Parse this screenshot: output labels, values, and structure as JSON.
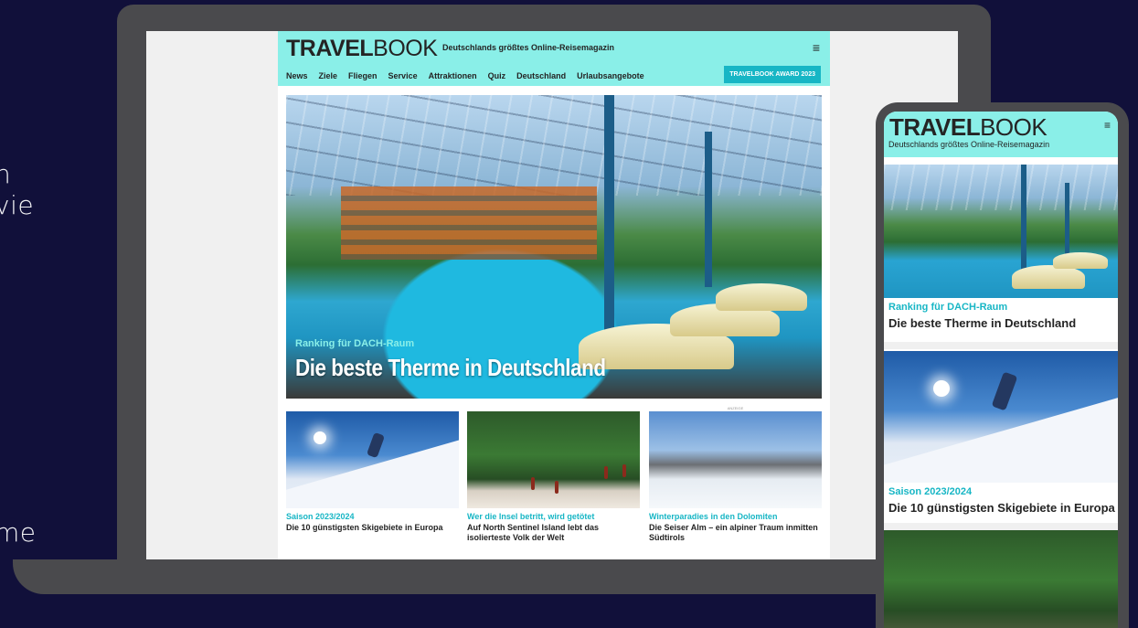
{
  "background": {
    "left_text": [
      "n",
      "vie",
      "me"
    ]
  },
  "colors": {
    "brand_cyan": "#8aefe8",
    "accent": "#17b6c5",
    "page_bg": "#11103a",
    "device": "#4a4a4d"
  },
  "desktop": {
    "logo_bold": "TRAVEL",
    "logo_light": "BOOK",
    "tagline": "Deutschlands größtes Online-Reisemagazin",
    "menu_icon": "≡",
    "nav": [
      "News",
      "Ziele",
      "Fliegen",
      "Service",
      "Attraktionen",
      "Quiz",
      "Deutschland",
      "Urlaubsangebote"
    ],
    "award_button": "TRAVELBOOK AWARD 2023",
    "hero": {
      "kicker": "Ranking für DACH-Raum",
      "title": "Die beste Therme in Deutschland"
    },
    "cards": [
      {
        "kicker": "Saison 2023/2024",
        "title": "Die 10 günstigsten Skigebiete in Europa",
        "image": "skier-image"
      },
      {
        "kicker": "Wer die Insel betritt, wird getötet",
        "title": "Auf North Sentinel Island lebt das isolierteste Volk der Welt",
        "image": "island-image"
      },
      {
        "kicker": "Winterparadies in den Dolomiten",
        "title": "Die Seiser Alm – ein alpiner Traum inmitten Südtirols",
        "image": "alps-image",
        "ad_label": "ANZEIGE"
      }
    ]
  },
  "mobile": {
    "logo_bold": "TRAVEL",
    "logo_light": "BOOK",
    "tagline": "Deutschlands größtes Online-Reisemagazin",
    "menu_icon": "≡",
    "articles": [
      {
        "kicker": "Ranking für DACH-Raum",
        "title": "Die beste Therme in Deutschland"
      },
      {
        "kicker": "Saison 2023/2024",
        "title": "Die 10 günstigsten Skigebiete in Europa"
      }
    ]
  }
}
